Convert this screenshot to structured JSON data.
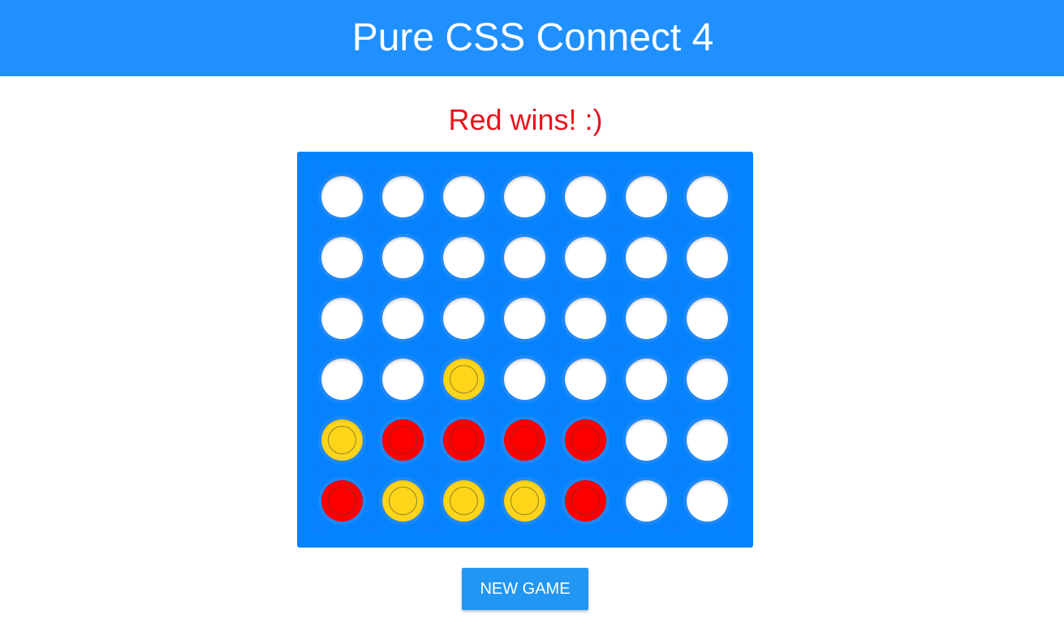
{
  "header": {
    "title": "Pure CSS Connect 4"
  },
  "status": {
    "message": "Red wins! :)"
  },
  "board": {
    "columns": 7,
    "rows": 6,
    "cells": [
      [
        "empty",
        "empty",
        "empty",
        "empty",
        "empty",
        "empty",
        "empty"
      ],
      [
        "empty",
        "empty",
        "empty",
        "empty",
        "empty",
        "empty",
        "empty"
      ],
      [
        "empty",
        "empty",
        "empty",
        "empty",
        "empty",
        "empty",
        "empty"
      ],
      [
        "empty",
        "empty",
        "yellow",
        "empty",
        "empty",
        "empty",
        "empty"
      ],
      [
        "yellow",
        "red",
        "red",
        "red",
        "red",
        "empty",
        "empty"
      ],
      [
        "red",
        "yellow",
        "yellow",
        "yellow",
        "red",
        "empty",
        "empty"
      ]
    ]
  },
  "actions": {
    "new_game_label": "NEW GAME"
  },
  "colors": {
    "header_bg": "#2190ff",
    "board_bg": "#0583ff",
    "cell_bg": "#1f8ff5",
    "red_disc": "#ff0000",
    "yellow_disc": "#ffd519",
    "empty_disc": "#ffffff",
    "status_text": "#e8141c",
    "button_bg": "#2196f3"
  }
}
